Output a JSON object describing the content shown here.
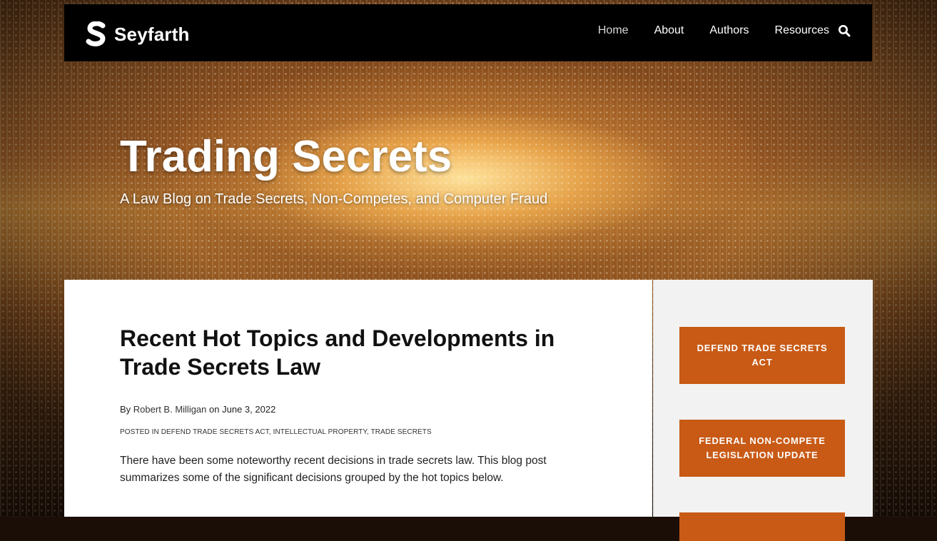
{
  "brand": {
    "name": "Seyfarth"
  },
  "nav": {
    "items": [
      {
        "label": "Home"
      },
      {
        "label": "About"
      },
      {
        "label": "Authors"
      },
      {
        "label": "Resources"
      }
    ]
  },
  "hero": {
    "title": "Trading Secrets",
    "subtitle": "A Law Blog on Trade Secrets, Non-Competes, and Computer Fraud"
  },
  "post": {
    "title": "Recent Hot Topics and Developments in Trade Secrets Law",
    "byline_prefix": "By",
    "author": "Robert B. Milligan",
    "byline_on": "on",
    "date": "June 3, 2022",
    "posted_in_label": "POSTED IN",
    "categories": [
      "DEFEND TRADE SECRETS ACT",
      "INTELLECTUAL PROPERTY",
      "TRADE SECRETS"
    ],
    "body": "There have been some noteworthy recent decisions in trade secrets law. This blog post summarizes some of the significant decisions grouped by the hot topics below."
  },
  "sidebar": {
    "buttons": [
      {
        "label": "DEFEND TRADE SECRETS ACT"
      },
      {
        "label": "FEDERAL NON-COMPETE LEGISLATION UPDATE"
      }
    ]
  },
  "colors": {
    "accent": "#c85a16",
    "nav_bg": "#000000"
  }
}
